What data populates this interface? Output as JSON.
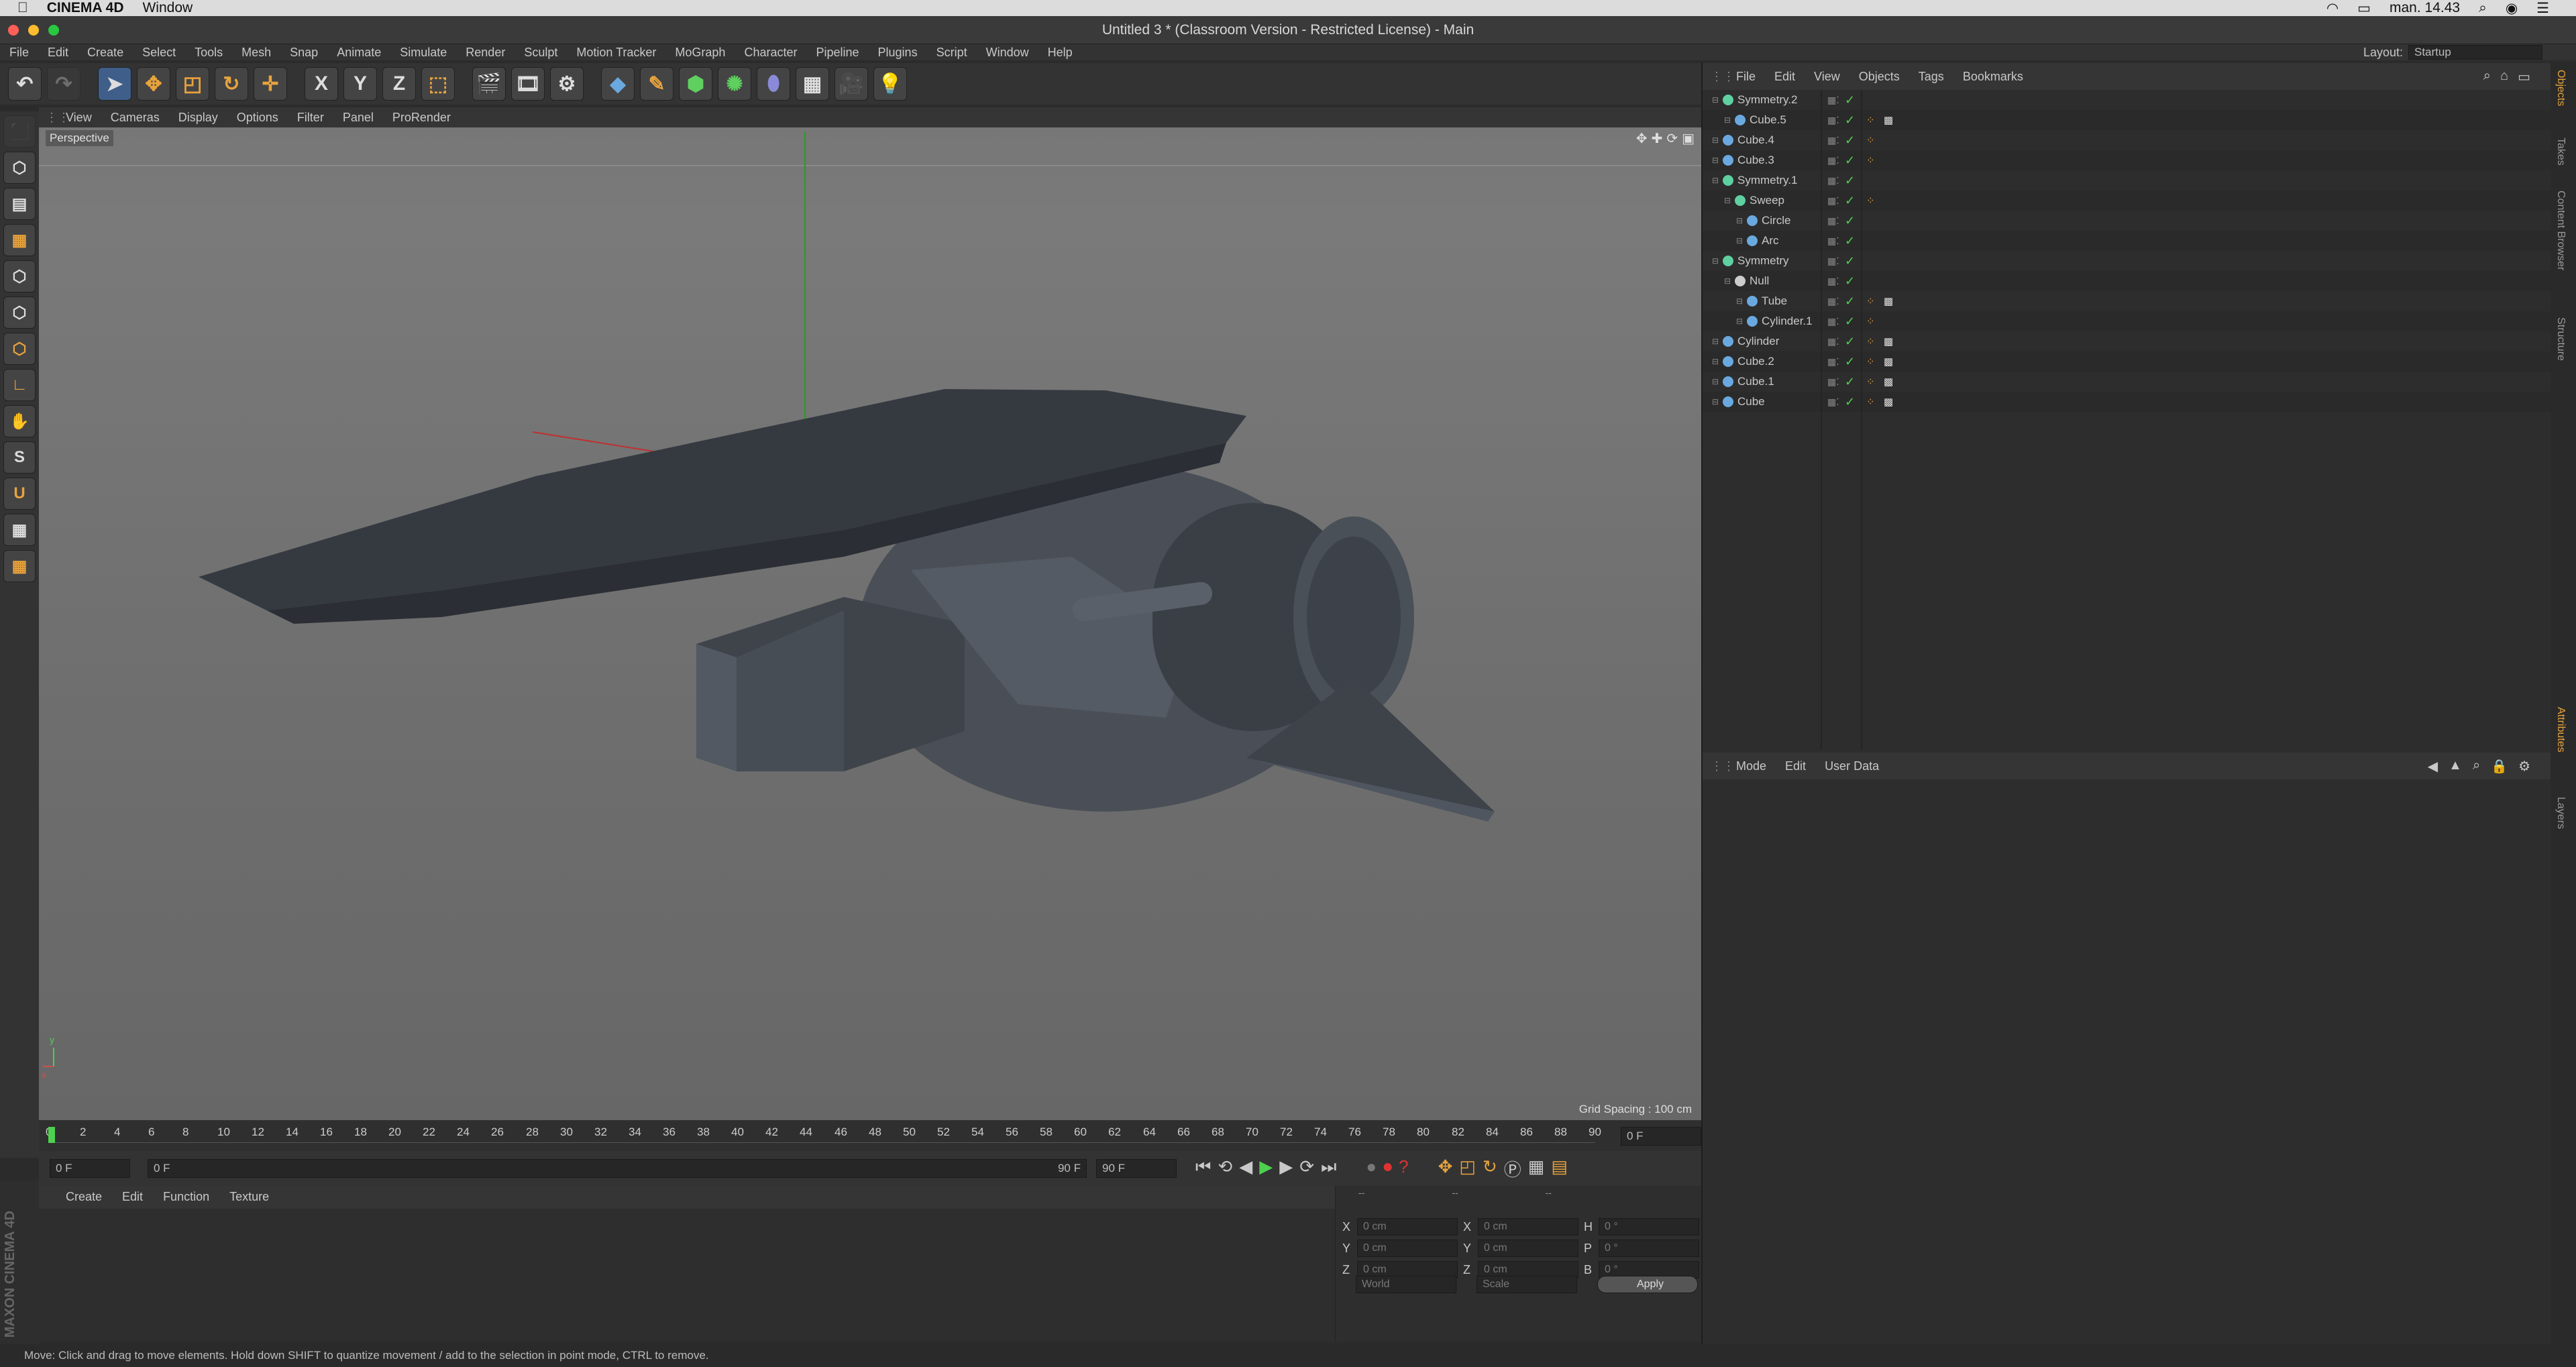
{
  "mac": {
    "app_name": "CINEMA 4D",
    "window_menu": "Window",
    "clock": "man. 14.43"
  },
  "title": "Untitled 3 * (Classroom Version - Restricted License) - Main",
  "menubar": {
    "items": [
      "File",
      "Edit",
      "Create",
      "Select",
      "Tools",
      "Mesh",
      "Snap",
      "Animate",
      "Simulate",
      "Render",
      "Sculpt",
      "Motion Tracker",
      "MoGraph",
      "Character",
      "Pipeline",
      "Plugins",
      "Script",
      "Window",
      "Help"
    ],
    "layout_label": "Layout:",
    "layout_value": "Startup"
  },
  "toolbar": {
    "axis_x": "X",
    "axis_y": "Y",
    "axis_z": "Z"
  },
  "viewport": {
    "menu": [
      "View",
      "Cameras",
      "Display",
      "Options",
      "Filter",
      "Panel",
      "ProRender"
    ],
    "camera_label": "Perspective",
    "grid_spacing": "Grid Spacing : 100 cm",
    "axis_y_label": "y",
    "axis_x_label": "x"
  },
  "timeline": {
    "ticks": [
      "0",
      "2",
      "4",
      "6",
      "8",
      "10",
      "12",
      "14",
      "16",
      "18",
      "20",
      "22",
      "24",
      "26",
      "28",
      "30",
      "32",
      "34",
      "36",
      "38",
      "40",
      "42",
      "44",
      "46",
      "48",
      "50",
      "52",
      "54",
      "56",
      "58",
      "60",
      "62",
      "64",
      "66",
      "68",
      "70",
      "72",
      "74",
      "76",
      "78",
      "80",
      "82",
      "84",
      "86",
      "88",
      "90"
    ],
    "current_frame": "0 F",
    "start_field": "0 F",
    "slider_left": "0 F",
    "slider_right": "90 F",
    "end_field": "90 F"
  },
  "material_panel": {
    "menu": [
      "Create",
      "Edit",
      "Function",
      "Texture"
    ]
  },
  "coords": {
    "col_headers": [
      "--",
      "--",
      "--"
    ],
    "rows": [
      {
        "a": "X",
        "av": "0 cm",
        "b": "X",
        "bv": "0 cm",
        "c": "H",
        "cv": "0 °"
      },
      {
        "a": "Y",
        "av": "0 cm",
        "b": "Y",
        "bv": "0 cm",
        "c": "P",
        "cv": "0 °"
      },
      {
        "a": "Z",
        "av": "0 cm",
        "b": "Z",
        "bv": "0 cm",
        "c": "B",
        "cv": "0 °"
      }
    ],
    "world": "World",
    "scale": "Scale",
    "apply": "Apply"
  },
  "objects_panel": {
    "menu": [
      "File",
      "Edit",
      "View",
      "Objects",
      "Tags",
      "Bookmarks"
    ],
    "items": [
      {
        "name": "Symmetry.2",
        "icon_color": "#5fd0a0",
        "indent": 0
      },
      {
        "name": "Cube.5",
        "icon_color": "#6aa9e0",
        "indent": 1
      },
      {
        "name": "Cube.4",
        "icon_color": "#6aa9e0",
        "indent": 0
      },
      {
        "name": "Cube.3",
        "icon_color": "#6aa9e0",
        "indent": 0
      },
      {
        "name": "Symmetry.1",
        "icon_color": "#5fd0a0",
        "indent": 0
      },
      {
        "name": "Sweep",
        "icon_color": "#5fd0a0",
        "indent": 1
      },
      {
        "name": "Circle",
        "icon_color": "#6aa9e0",
        "indent": 2
      },
      {
        "name": "Arc",
        "icon_color": "#6aa9e0",
        "indent": 2
      },
      {
        "name": "Symmetry",
        "icon_color": "#5fd0a0",
        "indent": 0
      },
      {
        "name": "Null",
        "icon_color": "#cccccc",
        "indent": 1
      },
      {
        "name": "Tube",
        "icon_color": "#6aa9e0",
        "indent": 2
      },
      {
        "name": "Cylinder.1",
        "icon_color": "#6aa9e0",
        "indent": 2
      },
      {
        "name": "Cylinder",
        "icon_color": "#6aa9e0",
        "indent": 0
      },
      {
        "name": "Cube.2",
        "icon_color": "#6aa9e0",
        "indent": 0
      },
      {
        "name": "Cube.1",
        "icon_color": "#6aa9e0",
        "indent": 0
      },
      {
        "name": "Cube",
        "icon_color": "#6aa9e0",
        "indent": 0
      }
    ]
  },
  "attributes_panel": {
    "menu": [
      "Mode",
      "Edit",
      "User Data"
    ]
  },
  "side_tabs": [
    "Objects",
    "Takes",
    "Content Browser",
    "Structure"
  ],
  "side_tabs_lower": [
    "Attributes",
    "Layers"
  ],
  "brand": "MAXON CINEMA 4D",
  "status": "Move: Click and drag to move elements. Hold down SHIFT to quantize movement / add to the selection in point mode, CTRL to remove.",
  "colors": {
    "accent_orange": "#e8a33d",
    "accent_blue": "#3f5f8a",
    "check_green": "#4fcf4f"
  }
}
